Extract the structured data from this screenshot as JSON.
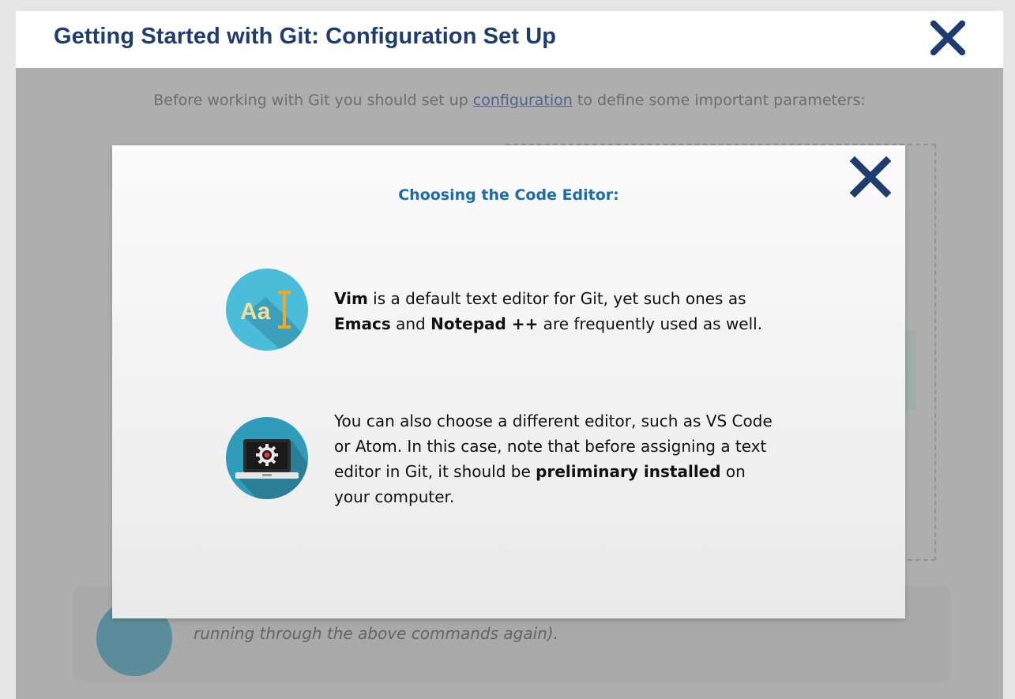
{
  "header": {
    "title": "Getting Started with Git: Configuration Set Up"
  },
  "background": {
    "intro_before": "Before working with Git you should set up ",
    "intro_link": "configuration",
    "intro_after": " to define some important parameters:",
    "tip_text": "- to list all the settings Git can find at that point and change them at any time (as well by running through the above commands again)."
  },
  "modal": {
    "title": "Choosing the Code Editor:",
    "items": [
      {
        "icon": "text-editor-icon",
        "parts": [
          {
            "text": "Vim",
            "bold": true
          },
          {
            "text": " is a default text editor for Git, yet such ones as ",
            "bold": false
          },
          {
            "text": "Emacs",
            "bold": true
          },
          {
            "text": " and ",
            "bold": false
          },
          {
            "text": "Notepad ++",
            "bold": true
          },
          {
            "text": " are frequently used as well.",
            "bold": false
          }
        ]
      },
      {
        "icon": "laptop-settings-icon",
        "parts": [
          {
            "text": "You can also choose a different editor, such as VS Code or Atom. In this case, note that before assigning a text editor in Git, it should be ",
            "bold": false
          },
          {
            "text": "preliminary installed",
            "bold": true
          },
          {
            "text": " on your computer.",
            "bold": false
          }
        ]
      }
    ]
  },
  "colors": {
    "title": "#1f3c6e",
    "modal_title": "#1b6ca8",
    "icon_circle": "#4bbcd9",
    "close_x": "#1f3c6e"
  }
}
